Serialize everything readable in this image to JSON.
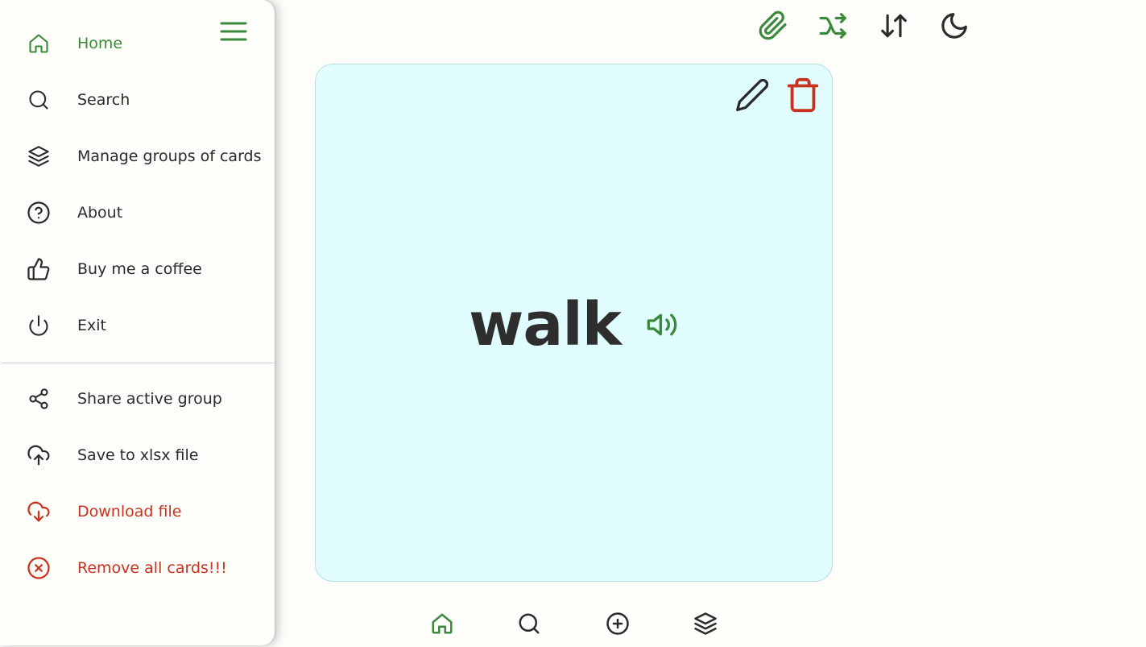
{
  "drawer": {
    "menu_icon": "hamburger-icon",
    "items": [
      {
        "label": "Home",
        "icon": "home-icon",
        "state": "active"
      },
      {
        "label": "Search",
        "icon": "search-icon"
      },
      {
        "label": "Manage groups of cards",
        "icon": "layers-icon"
      },
      {
        "label": "About",
        "icon": "help-circle-icon"
      },
      {
        "label": "Buy me a coffee",
        "icon": "thumbs-up-icon"
      },
      {
        "label": "Exit",
        "icon": "power-icon"
      }
    ],
    "secondary_items": [
      {
        "label": "Share active group",
        "icon": "share-icon"
      },
      {
        "label": "Save to xlsx file",
        "icon": "cloud-upload-icon"
      },
      {
        "label": "Download file",
        "icon": "cloud-download-icon",
        "state": "danger"
      },
      {
        "label": "Remove all cards!!!",
        "icon": "x-circle-icon",
        "state": "danger"
      }
    ]
  },
  "toolbar": {
    "buttons": [
      {
        "icon": "paperclip-icon",
        "color": "#3b8a3b"
      },
      {
        "icon": "shuffle-icon",
        "color": "#3b8a3b"
      },
      {
        "icon": "sort-arrows-icon",
        "color": "#2b2b2b"
      },
      {
        "icon": "moon-icon",
        "color": "#2b2b2b"
      }
    ]
  },
  "card": {
    "word": "walk",
    "background": "#e0fcfe",
    "actions": [
      {
        "icon": "pencil-icon",
        "color": "#2b2b2b"
      },
      {
        "icon": "trash-icon",
        "color": "#c9321f"
      }
    ],
    "speaker_icon": "speaker-icon"
  },
  "bottom_nav": {
    "buttons": [
      {
        "icon": "home-icon",
        "color": "#3b8a3b",
        "state": "active"
      },
      {
        "icon": "search-icon",
        "color": "#2b2b2b"
      },
      {
        "icon": "plus-circle-icon",
        "color": "#2b2b2b"
      },
      {
        "icon": "layers-icon",
        "color": "#2b2b2b"
      }
    ]
  },
  "colors": {
    "accent_green": "#3b8a3b",
    "danger_red": "#c9321f",
    "text": "#2b2b2b",
    "background": "#fdfdfa"
  }
}
